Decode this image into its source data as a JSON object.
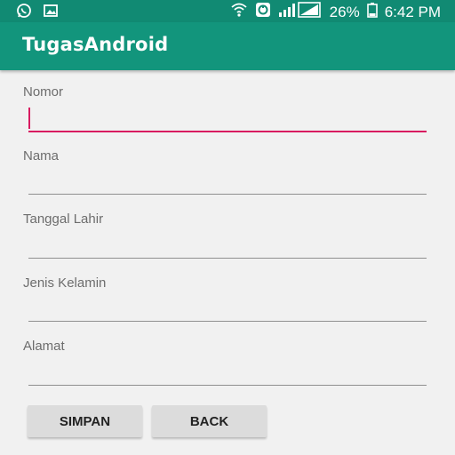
{
  "status_bar": {
    "icons": [
      "whatsapp-icon",
      "image-icon",
      "wifi-icon",
      "data-saver-icon",
      "signal-icon"
    ],
    "battery": "26%",
    "time": "6:42 PM"
  },
  "app_bar": {
    "title": "TugasAndroid"
  },
  "form": {
    "fields": [
      {
        "label": "Nomor",
        "value": ""
      },
      {
        "label": "Nama",
        "value": ""
      },
      {
        "label": "Tanggal Lahir",
        "value": ""
      },
      {
        "label": "Jenis Kelamin",
        "value": ""
      },
      {
        "label": "Alamat",
        "value": ""
      }
    ]
  },
  "buttons": {
    "save_label": "SIMPAN",
    "back_label": "BACK"
  },
  "colors": {
    "status_bar": "#118a73",
    "app_bar": "#12957c",
    "accent": "#d81b60",
    "background": "#f1f1f1"
  }
}
